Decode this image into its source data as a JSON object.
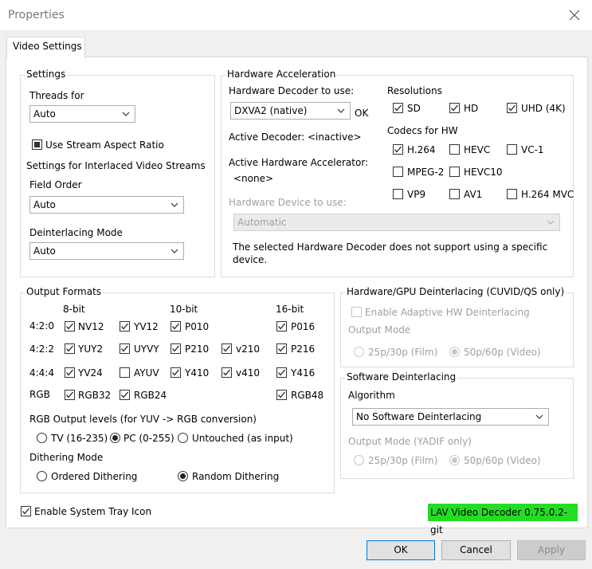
{
  "window": {
    "title": "Properties"
  },
  "tab": {
    "label": "Video Settings"
  },
  "settings": {
    "legend": "Settings",
    "threads_label": "Threads for",
    "threads_value": "Auto",
    "use_aspect": "Use Stream Aspect Ratio",
    "interlaced_label": "Settings for Interlaced Video Streams",
    "field_order_label": "Field Order",
    "field_order_value": "Auto",
    "deint_mode_label": "Deinterlacing Mode",
    "deint_mode_value": "Auto"
  },
  "hwaccel": {
    "legend": "Hardware Acceleration",
    "decoder_label": "Hardware Decoder to use:",
    "decoder_value": "DXVA2 (native)",
    "decoder_status": "OK",
    "active_decoder_label": "Active Decoder:",
    "active_decoder_value": "<inactive>",
    "active_accel_label": "Active Hardware Accelerator:",
    "active_accel_value": "<none>",
    "device_label": "Hardware Device to use:",
    "device_value": "Automatic",
    "device_note_line1": "The selected Hardware Decoder does not support using a specific",
    "device_note_line2": "device.",
    "resolutions_label": "Resolutions",
    "res_sd": "SD",
    "res_hd": "HD",
    "res_uhd": "UHD (4K)",
    "codecs_label": "Codecs for HW",
    "codec_h264": "H.264",
    "codec_hevc": "HEVC",
    "codec_vc1": "VC-1",
    "codec_mpeg2": "MPEG-2",
    "codec_hevc10": "HEVC10",
    "codec_vp9": "VP9",
    "codec_av1": "AV1",
    "codec_h264mvc": "H.264 MVC"
  },
  "output": {
    "legend": "Output Formats",
    "col_8bit": "8-bit",
    "col_10bit": "10-bit",
    "col_16bit": "16-bit",
    "row_420": "4:2:0",
    "row_422": "4:2:2",
    "row_444": "4:4:4",
    "row_rgb": "RGB",
    "nv12": "NV12",
    "yv12": "YV12",
    "p010": "P010",
    "p016": "P016",
    "yuy2": "YUY2",
    "uyvy": "UYVY",
    "p210": "P210",
    "v210": "v210",
    "p216": "P216",
    "yv24": "YV24",
    "ayuv": "AYUV",
    "y410": "Y410",
    "v410": "v410",
    "y416": "Y416",
    "rgb32": "RGB32",
    "rgb24": "RGB24",
    "rgb48": "RGB48",
    "rgb_levels_label": "RGB Output levels (for YUV -> RGB conversion)",
    "level_tv": "TV (16-235)",
    "level_pc": "PC (0-255)",
    "level_untouched": "Untouched (as input)",
    "dither_label": "Dithering Mode",
    "dither_ordered": "Ordered Dithering",
    "dither_random": "Random Dithering"
  },
  "hwdeint": {
    "legend": "Hardware/GPU Deinterlacing (CUVID/QS only)",
    "adaptive": "Enable Adaptive HW Deinterlacing",
    "output_mode_label": "Output Mode",
    "mode_film": "25p/30p (Film)",
    "mode_video": "50p/60p (Video)"
  },
  "swdeint": {
    "legend": "Software Deinterlacing",
    "algorithm_label": "Algorithm",
    "algorithm_value": "No Software Deinterlacing",
    "output_mode_label": "Output Mode (YADIF only)",
    "mode_film": "25p/30p (Film)",
    "mode_video": "50p/60p (Video)"
  },
  "tray": {
    "label": "Enable System Tray Icon"
  },
  "version": {
    "text": "LAV Video Decoder 0.75.0.2-git",
    "color": "#25dc25"
  },
  "buttons": {
    "ok": "OK",
    "cancel": "Cancel",
    "apply": "Apply"
  }
}
